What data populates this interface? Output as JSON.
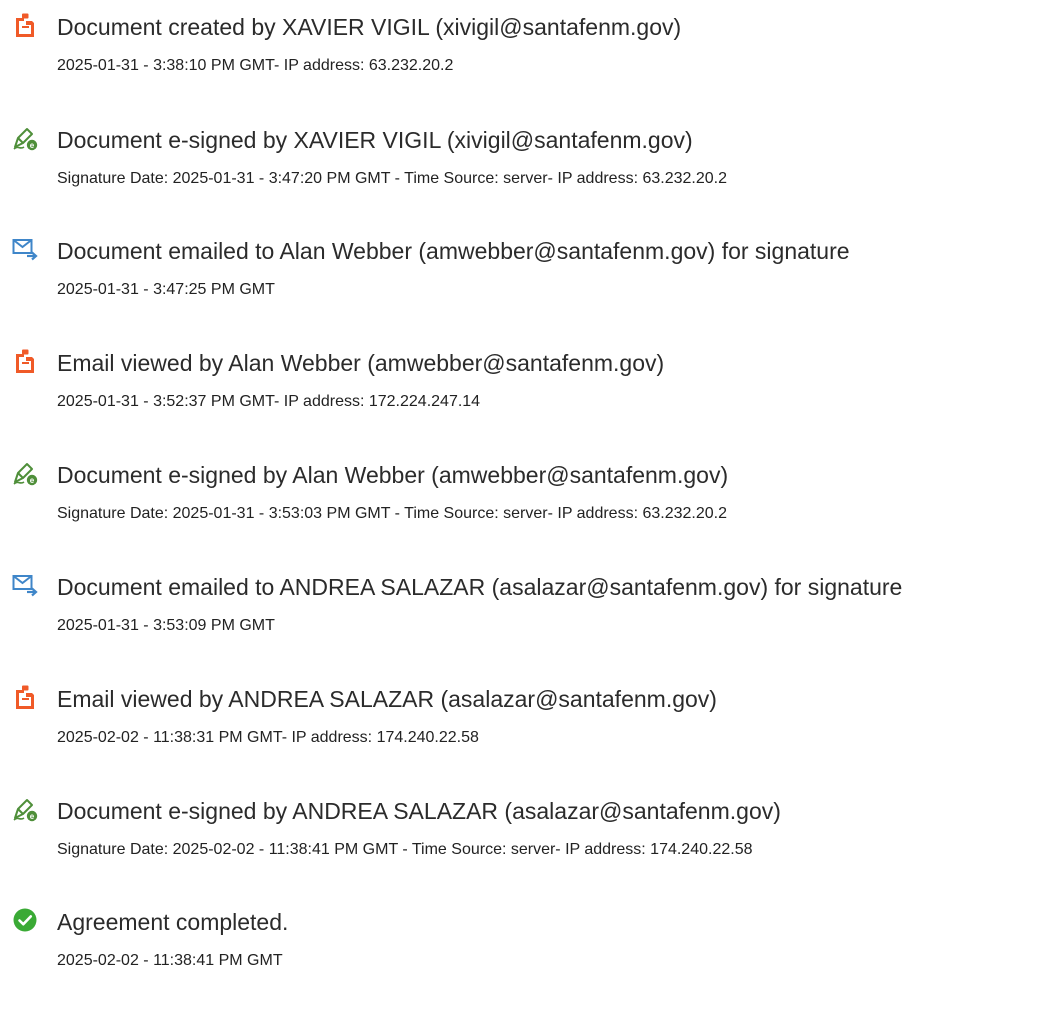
{
  "colors": {
    "created_icon": "#f05a28",
    "esign_icon": "#4f8f3a",
    "email_icon": "#3f86c9",
    "complete_icon": "#3aaa35",
    "text": "#2b2b2b"
  },
  "events": [
    {
      "icon": "document-created-icon",
      "title": "Document created by XAVIER VIGIL (xivigil@santafenm.gov)",
      "detail": "2025-01-31 - 3:38:10 PM GMT- IP address: 63.232.20.2"
    },
    {
      "icon": "e-sign-pen-icon",
      "title": "Document e-signed by XAVIER VIGIL (xivigil@santafenm.gov)",
      "detail": "Signature Date: 2025-01-31 - 3:47:20 PM GMT - Time Source: server- IP address: 63.232.20.2"
    },
    {
      "icon": "email-sent-icon",
      "title": "Document emailed to Alan Webber (amwebber@santafenm.gov) for signature",
      "detail": "2025-01-31 - 3:47:25 PM GMT"
    },
    {
      "icon": "email-viewed-icon",
      "title": "Email viewed by Alan Webber (amwebber@santafenm.gov)",
      "detail": "2025-01-31 - 3:52:37 PM GMT- IP address: 172.224.247.14"
    },
    {
      "icon": "e-sign-pen-icon",
      "title": "Document e-signed by Alan Webber (amwebber@santafenm.gov)",
      "detail": "Signature Date: 2025-01-31 - 3:53:03 PM GMT - Time Source: server- IP address: 63.232.20.2"
    },
    {
      "icon": "email-sent-icon",
      "title": "Document emailed to ANDREA SALAZAR (asalazar@santafenm.gov) for signature",
      "detail": "2025-01-31 - 3:53:09 PM GMT"
    },
    {
      "icon": "email-viewed-icon",
      "title": "Email viewed by ANDREA SALAZAR (asalazar@santafenm.gov)",
      "detail": "2025-02-02 - 11:38:31 PM GMT- IP address: 174.240.22.58"
    },
    {
      "icon": "e-sign-pen-icon",
      "title": "Document e-signed by ANDREA SALAZAR (asalazar@santafenm.gov)",
      "detail": "Signature Date: 2025-02-02 - 11:38:41 PM GMT - Time Source: server- IP address: 174.240.22.58"
    },
    {
      "icon": "agreement-completed-icon",
      "title": "Agreement completed.",
      "detail": "2025-02-02 - 11:38:41 PM GMT"
    }
  ]
}
